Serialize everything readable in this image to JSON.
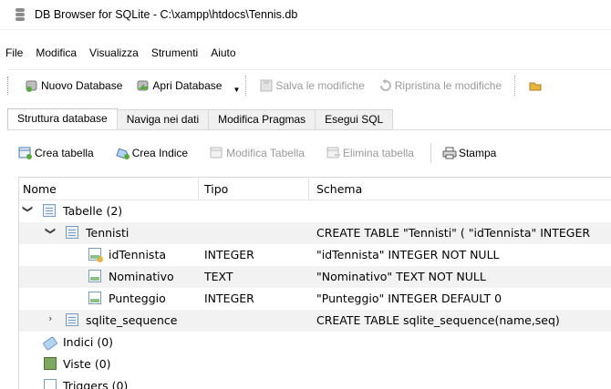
{
  "window": {
    "title": "DB Browser for SQLite - C:\\xampp\\htdocs\\Tennis.db"
  },
  "menu": [
    {
      "label": "File"
    },
    {
      "label": "Modifica"
    },
    {
      "label": "Visualizza"
    },
    {
      "label": "Strumenti"
    },
    {
      "label": "Aiuto"
    }
  ],
  "toolbar": {
    "new_db": "Nuovo Database",
    "open_db": "Apri Database",
    "save": "Salva le modifiche",
    "revert": "Ripristina le modifiche"
  },
  "tabs": [
    {
      "label": "Struttura database",
      "active": true
    },
    {
      "label": "Naviga nei dati"
    },
    {
      "label": "Modifica Pragmas"
    },
    {
      "label": "Esegui SQL"
    }
  ],
  "structure_toolbar": {
    "create_table": "Crea tabella",
    "create_index": "Crea Indice",
    "modify_table": "Modifica Tabella",
    "delete_table": "Elimina tabella",
    "print": "Stampa"
  },
  "tree": {
    "headers": {
      "name": "Nome",
      "type": "Tipo",
      "schema": "Schema"
    },
    "tables_group": "Tabelle (2)",
    "tennisti": {
      "name": "Tennisti",
      "schema": "CREATE TABLE \"Tennisti\" ( \"idTennista\" INTEGER"
    },
    "fields": [
      {
        "name": "idTennista",
        "type": "INTEGER",
        "schema": "\"idTennista\" INTEGER NOT NULL"
      },
      {
        "name": "Nominativo",
        "type": "TEXT",
        "schema": "\"Nominativo\" TEXT NOT NULL"
      },
      {
        "name": "Punteggio",
        "type": "INTEGER",
        "schema": "\"Punteggio\" INTEGER DEFAULT 0"
      }
    ],
    "sqlite_sequence": {
      "name": "sqlite_sequence",
      "schema": "CREATE TABLE sqlite_sequence(name,seq)"
    },
    "indices": "Indici (0)",
    "views": "Viste (0)",
    "triggers": "Triggers (0)"
  }
}
